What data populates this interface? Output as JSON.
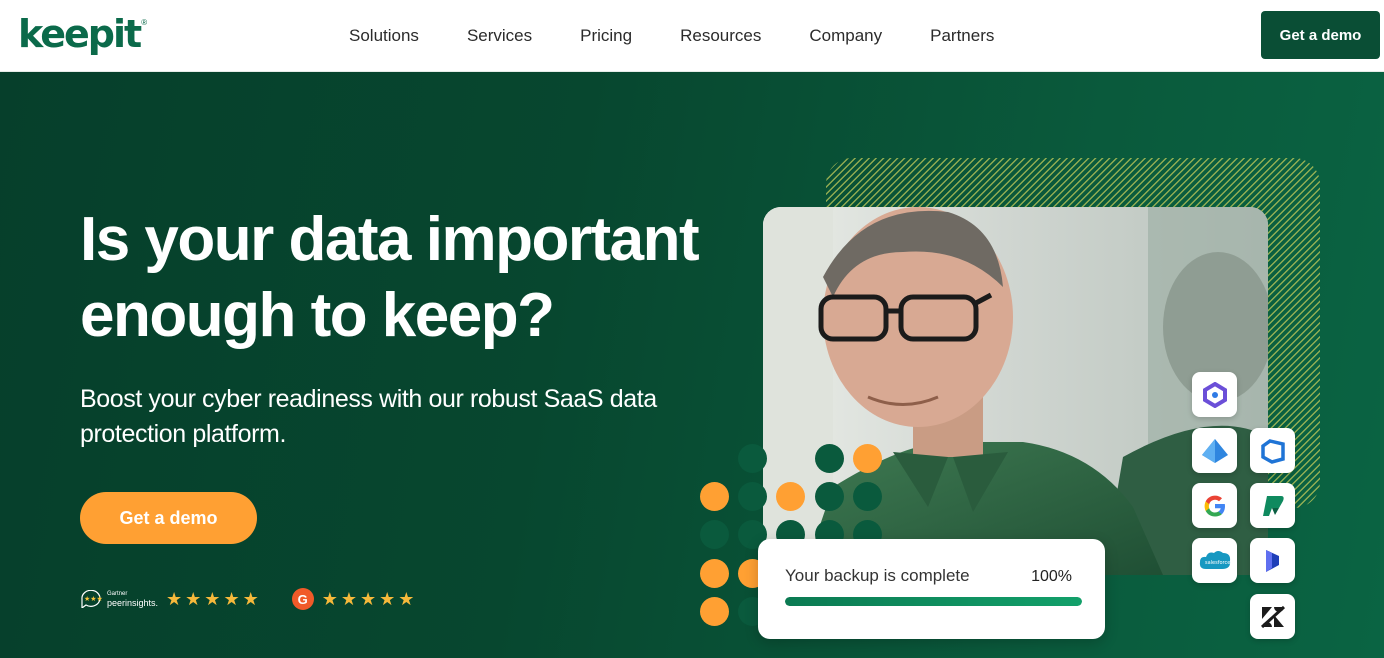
{
  "header": {
    "logo_text": "keepit",
    "logo_mark": "®",
    "nav": [
      "Solutions",
      "Services",
      "Pricing",
      "Resources",
      "Company",
      "Partners"
    ],
    "cta_label": "Get a demo"
  },
  "hero": {
    "headline": "Is your data important enough to keep?",
    "subhead": "Boost your cyber readiness with our robust SaaS data protection platform.",
    "cta_label": "Get a demo"
  },
  "ratings": {
    "gartner_small": "Gartner",
    "gartner_peer": "peerinsights.",
    "gartner_stars": "★★★★★",
    "g2_logo": "G",
    "g2_stars": "★★★★★"
  },
  "backup": {
    "label": "Your backup is complete",
    "percent_text": "100%",
    "progress": 1.0
  },
  "apps": [
    "microsoft-365-icon",
    "entra-id-icon",
    "azure-devops-icon",
    "google-icon",
    "power-platform-icon",
    "salesforce-icon",
    "dynamics-365-icon",
    "zendesk-icon"
  ],
  "colors": {
    "brand": "#0b6a4a",
    "dark_green": "#0a4e35",
    "accent_orange": "#ffa033"
  }
}
